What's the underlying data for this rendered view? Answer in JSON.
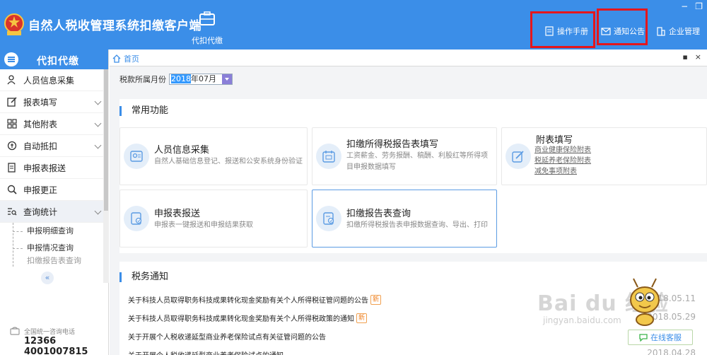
{
  "header": {
    "app_title": "自然人税收管理系统扣缴客户端",
    "module_label": "代扣代缴",
    "links": {
      "manual": "操作手册",
      "notice": "通知公告",
      "enterprise": "企业管理"
    },
    "window_controls": [
      "−",
      "❐"
    ]
  },
  "sidebar": {
    "title": "代扣代缴",
    "items": [
      {
        "label": "人员信息采集",
        "icon": "person-icon",
        "has_children": false
      },
      {
        "label": "报表填写",
        "icon": "edit-icon",
        "has_children": true
      },
      {
        "label": "其他附表",
        "icon": "grid-icon",
        "has_children": true
      },
      {
        "label": "自动抵扣",
        "icon": "deduct-icon",
        "has_children": true
      },
      {
        "label": "申报表报送",
        "icon": "document-icon",
        "has_children": false
      },
      {
        "label": "申报更正",
        "icon": "search-icon",
        "has_children": false
      },
      {
        "label": "查询统计",
        "icon": "list-search-icon",
        "has_children": true
      }
    ],
    "sub_items": [
      "申报明细查询",
      "申报情况查询",
      "扣缴报告表查询"
    ],
    "collapse_glyph": "«",
    "hotline": {
      "label": "全国统一咨询电话",
      "number1": "12366",
      "number2": "4001007815"
    }
  },
  "tabbar": {
    "home_label": "首页",
    "controls": [
      "▪",
      "×"
    ]
  },
  "month": {
    "label": "税款所属月份",
    "year": "2018",
    "rest": "年07月"
  },
  "common": {
    "title": "常用功能",
    "cards": [
      {
        "title": "人员信息采集",
        "desc": [
          "自然人基础信息登记、报送和公安系统身份验证"
        ],
        "icon": "person-card-icon"
      },
      {
        "title": "扣缴所得税报告表填写",
        "desc": [
          "工资薪金、劳务报酬、稿酬、利股红等所得项",
          "目申报数据填写"
        ],
        "icon": "calendar-icon"
      },
      {
        "title": "附表填写",
        "links": [
          "商业健康保险附表",
          "税延养老保险附表",
          "减免事项附表"
        ],
        "icon": "pencil-icon"
      },
      {
        "title": "申报表报送",
        "desc": [
          "申报表一键报送和申报结果获取"
        ],
        "icon": "send-report-icon"
      },
      {
        "title": "扣缴报告表查询",
        "desc": [
          "扣缴所得税报告表申报数据查询、导出、打印"
        ],
        "icon": "report-check-icon"
      }
    ]
  },
  "notices": {
    "title": "税务通知",
    "items": [
      {
        "text": "关于科技人员取得职务科技成果转化现金奖励有关个人所得税征管问题的公告",
        "new": "新",
        "date": "2018.05.11"
      },
      {
        "text": "关于科技人员取得职务科技成果转化现金奖励有关个人所得税政策的通知",
        "new": "新",
        "date": "2018.05.29"
      },
      {
        "text": "关于开展个人税收递延型商业养老保险试点有关征管问题的公告",
        "new": "",
        "date": ""
      },
      {
        "text": "关于开展个人税收递延型商业养老保险试点的通知",
        "new": "",
        "date": "2018.04.28"
      }
    ]
  },
  "online_service": "在线客服",
  "watermark": {
    "text": "Bai du 经验",
    "sub": "jingyan.baidu.com"
  },
  "colors": {
    "primary": "#3b8ee8",
    "highlight": "#e5161c",
    "new_badge": "#f08020"
  }
}
